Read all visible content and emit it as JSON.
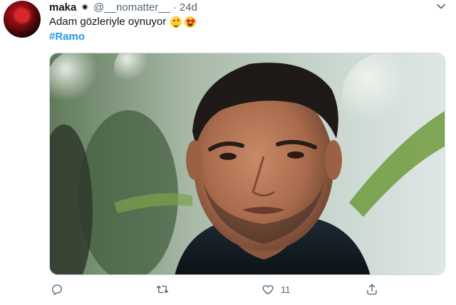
{
  "tweet": {
    "author_name": "maka",
    "badge_icon": "sparkle-icon",
    "handle": "@__nomatter__",
    "separator": "·",
    "time": "24d",
    "text": "Adam gözleriyle oynuyor",
    "emojis": [
      "winking-face-emoji",
      "heart-eyes-emoji"
    ],
    "hashtag": "#Ramo",
    "media_icon": "photo"
  },
  "actions": {
    "reply_icon": "reply-icon",
    "retweet_icon": "retweet-icon",
    "like_icon": "like-icon",
    "like_count": "11",
    "share_icon": "share-icon"
  },
  "colors": {
    "link": "#1d9bf0",
    "secondary_text": "#536471",
    "primary_text": "#0f1419"
  }
}
